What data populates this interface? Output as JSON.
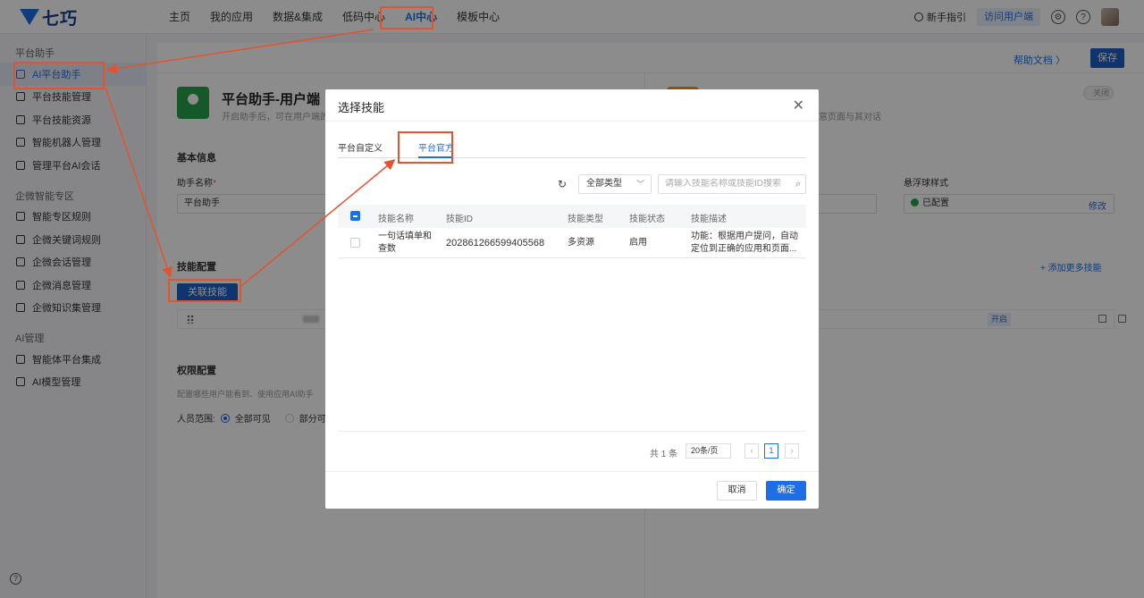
{
  "brand": {
    "name": "七巧"
  },
  "nav": {
    "items": [
      {
        "label": "主页"
      },
      {
        "label": "我的应用"
      },
      {
        "label": "数据&集成"
      },
      {
        "label": "低码中心"
      },
      {
        "label": "AI中心"
      },
      {
        "label": "模板中心"
      }
    ],
    "guide_label": "新手指引",
    "visit_label": "访问用户端"
  },
  "sidebar": {
    "groups": [
      {
        "title": "平台助手",
        "items": [
          {
            "label": "AI平台助手"
          },
          {
            "label": "平台技能管理"
          },
          {
            "label": "平台技能资源"
          },
          {
            "label": "智能机器人管理"
          },
          {
            "label": "管理平台AI会话"
          }
        ]
      },
      {
        "title": "企微智能专区",
        "items": [
          {
            "label": "智能专区规则"
          },
          {
            "label": "企微关键词规则"
          },
          {
            "label": "企微会话管理"
          },
          {
            "label": "企微消息管理"
          },
          {
            "label": "企微知识集管理"
          }
        ]
      },
      {
        "title": "AI管理",
        "items": [
          {
            "label": "智能体平台集成"
          },
          {
            "label": "AI模型管理"
          }
        ]
      }
    ]
  },
  "page": {
    "help_doc": "帮助文档 〉",
    "save": "保存",
    "app_title": "平台助手-用户端",
    "app_desc": "开启助手后，可在用户端的",
    "right_desc": "意页面与其对话",
    "toggle_off": "关闭",
    "basic_info": "基本信息",
    "assistant_name_label": "助手名称",
    "assistant_name_value": "平台助手",
    "float_style_label": "悬浮球样式",
    "float_style_value": "已配置",
    "modify": "修改",
    "skill_config": "技能配置",
    "link_skill": "关联技能",
    "add_more_skill": "+ 添加更多技能",
    "skill_status": "开启",
    "perm_config": "权限配置",
    "perm_hint": "配置哪些用户能看到、使用应用AI助手",
    "scope_label": "人员范围:",
    "scope_all": "全部可见",
    "scope_part": "部分可"
  },
  "modal": {
    "title": "选择技能",
    "tabs": [
      {
        "label": "平台自定义"
      },
      {
        "label": "平台官方"
      }
    ],
    "type_filter": "全部类型",
    "search_placeholder": "请输入技能名称或技能ID搜索",
    "columns": [
      "技能名称",
      "技能ID",
      "技能类型",
      "技能状态",
      "技能描述"
    ],
    "rows": [
      {
        "name": "一句话填单和查数",
        "id": "202861266599405568",
        "type": "多资源",
        "status": "启用",
        "desc": "功能：根据用户提问，自动定位到正确的应用和页面..."
      }
    ],
    "pager": {
      "total": "共 1 条",
      "page_size": "20条/页",
      "current": "1"
    },
    "cancel": "取消",
    "ok": "确定"
  }
}
